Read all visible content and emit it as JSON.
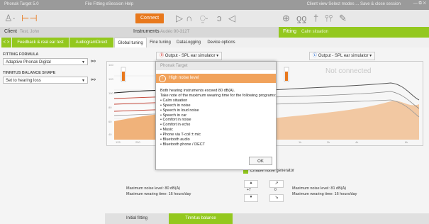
{
  "titlebar": {
    "title": "Phonak Target 5.0",
    "menu": "File   Fitting   eSession   Help",
    "right": "Client view     Select modes ...     Save & close session",
    "window_controls": "— ⧉ ✕"
  },
  "toolbar": {
    "connect_label": "Connect"
  },
  "client": {
    "label": "Client",
    "name": "Test, John",
    "instruments_label": "Instruments",
    "instruments_value": "Audéo 90-312T",
    "fitting_label": "Fitting",
    "fitting_program": "Calm situation"
  },
  "tabs": [
    {
      "label": "< >"
    },
    {
      "label": "Feedback & real ear test"
    },
    {
      "label": "AudiogramDirect"
    },
    {
      "label": "Global tuning"
    },
    {
      "label": "Fine tuning"
    },
    {
      "label": "DataLogging"
    },
    {
      "label": "Device options"
    }
  ],
  "left": {
    "formula_label": "FITTING FORMULA",
    "formula_value": "Adaptive Phonak Digital",
    "tinnitus_label": "TINNITUS BALANCE SHAPE",
    "tinnitus_value": "Set to hearing loss"
  },
  "output": {
    "right_label": "Output - SPL ear simulator",
    "left_label": "Output - SPL ear simulator",
    "not_connected": "Not connected"
  },
  "graph": {
    "y_ticks": [
      "140",
      "120",
      "100",
      "80",
      "60",
      "40"
    ],
    "x_ticks_left": [
      "125",
      "250",
      "500",
      "1k",
      "2k",
      "4k",
      "8k"
    ],
    "x_ticks_right": [
      "250",
      "500",
      "1k",
      "2k",
      "4k",
      "8k"
    ]
  },
  "modal": {
    "title": "Phonak Target",
    "warning": "High noise level",
    "line1": "Both hearing instruments exceed 80 dB(A).",
    "line2": "Take note of the maximum wearing time for the following programs:",
    "programs": [
      "• Calm situation",
      "• Speech in noise",
      "• Speech in loud noise",
      "• Speech in car",
      "• Comfort in noise",
      "• Comfort in echo",
      "• Music",
      "• Phone via T-coil ± mic",
      "• Bluetooth audio",
      "• Bluetooth phone / DECT"
    ],
    "ok_label": "OK"
  },
  "noise": {
    "enable_label": "Enable noise generator",
    "right_level": "Maximum noise level: 80 dB(A)",
    "right_time": "Maximum wearing time: 16 hours/day",
    "left_level": "Maximum noise level: 81 dB(A)",
    "left_time": "Maximum wearing time: 16 hours/day",
    "step_value_left": "+7",
    "step_value_right": "0"
  },
  "bottom_tabs": [
    {
      "label": "Initial fitting"
    },
    {
      "label": "Tinnitus balance"
    }
  ],
  "colors": {
    "accent_orange": "#e8781c",
    "accent_green": "#93c81e",
    "fill_orange": "#f0b27a"
  }
}
